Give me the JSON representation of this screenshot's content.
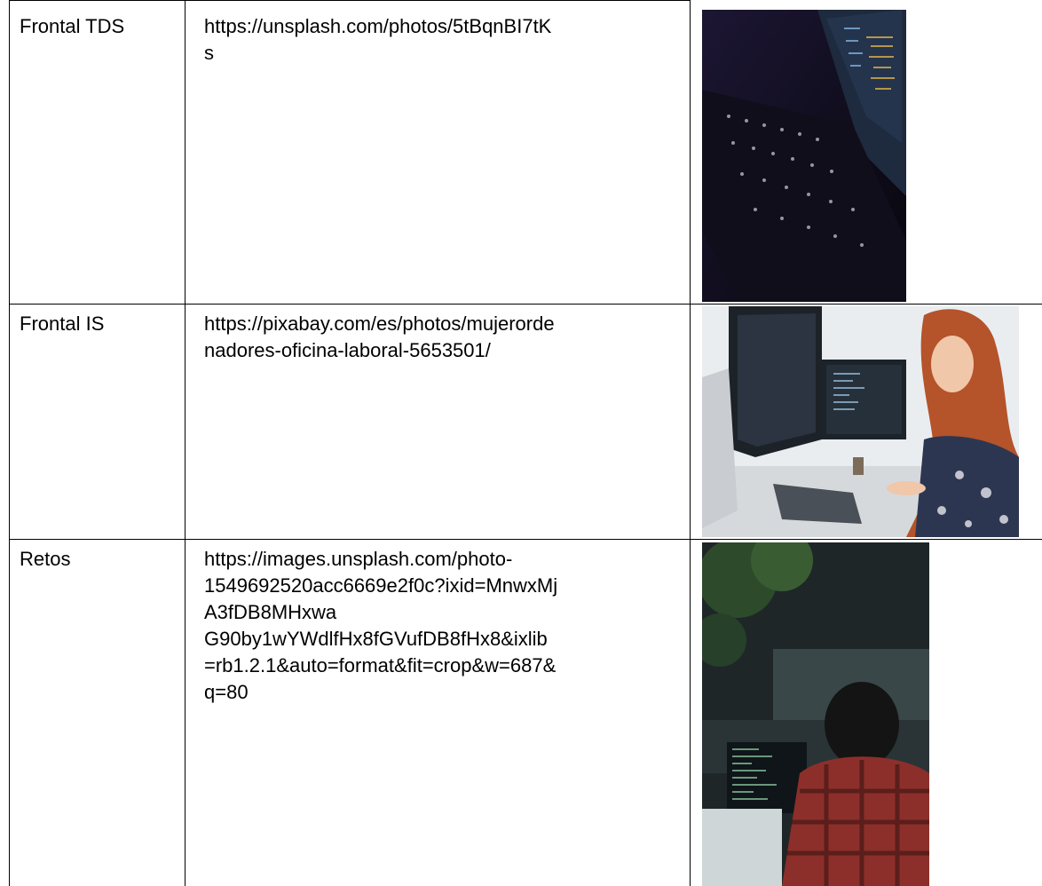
{
  "rows": [
    {
      "label": "Frontal TDS",
      "url": "https://unsplash.com/photos/5tBqnBI7tK\ns",
      "image": "laptop-keyboard-photo"
    },
    {
      "label": "Frontal IS",
      "url": "https://pixabay.com/es/photos/mujerorde\nnadores-oficina-laboral-5653501/",
      "image": "woman-at-computer-photo"
    },
    {
      "label": "Retos",
      "url": "https://images.unsplash.com/photo-\n1549692520acc6669e2f0c?ixid=MnwxMj\nA3fDB8MHxwa\nG90by1wYWdlfHx8fGVufDB8fHx8&ixlib\n=rb1.2.1&auto=format&fit=crop&w=687&\nq=80",
      "image": "man-coding-photo"
    }
  ]
}
